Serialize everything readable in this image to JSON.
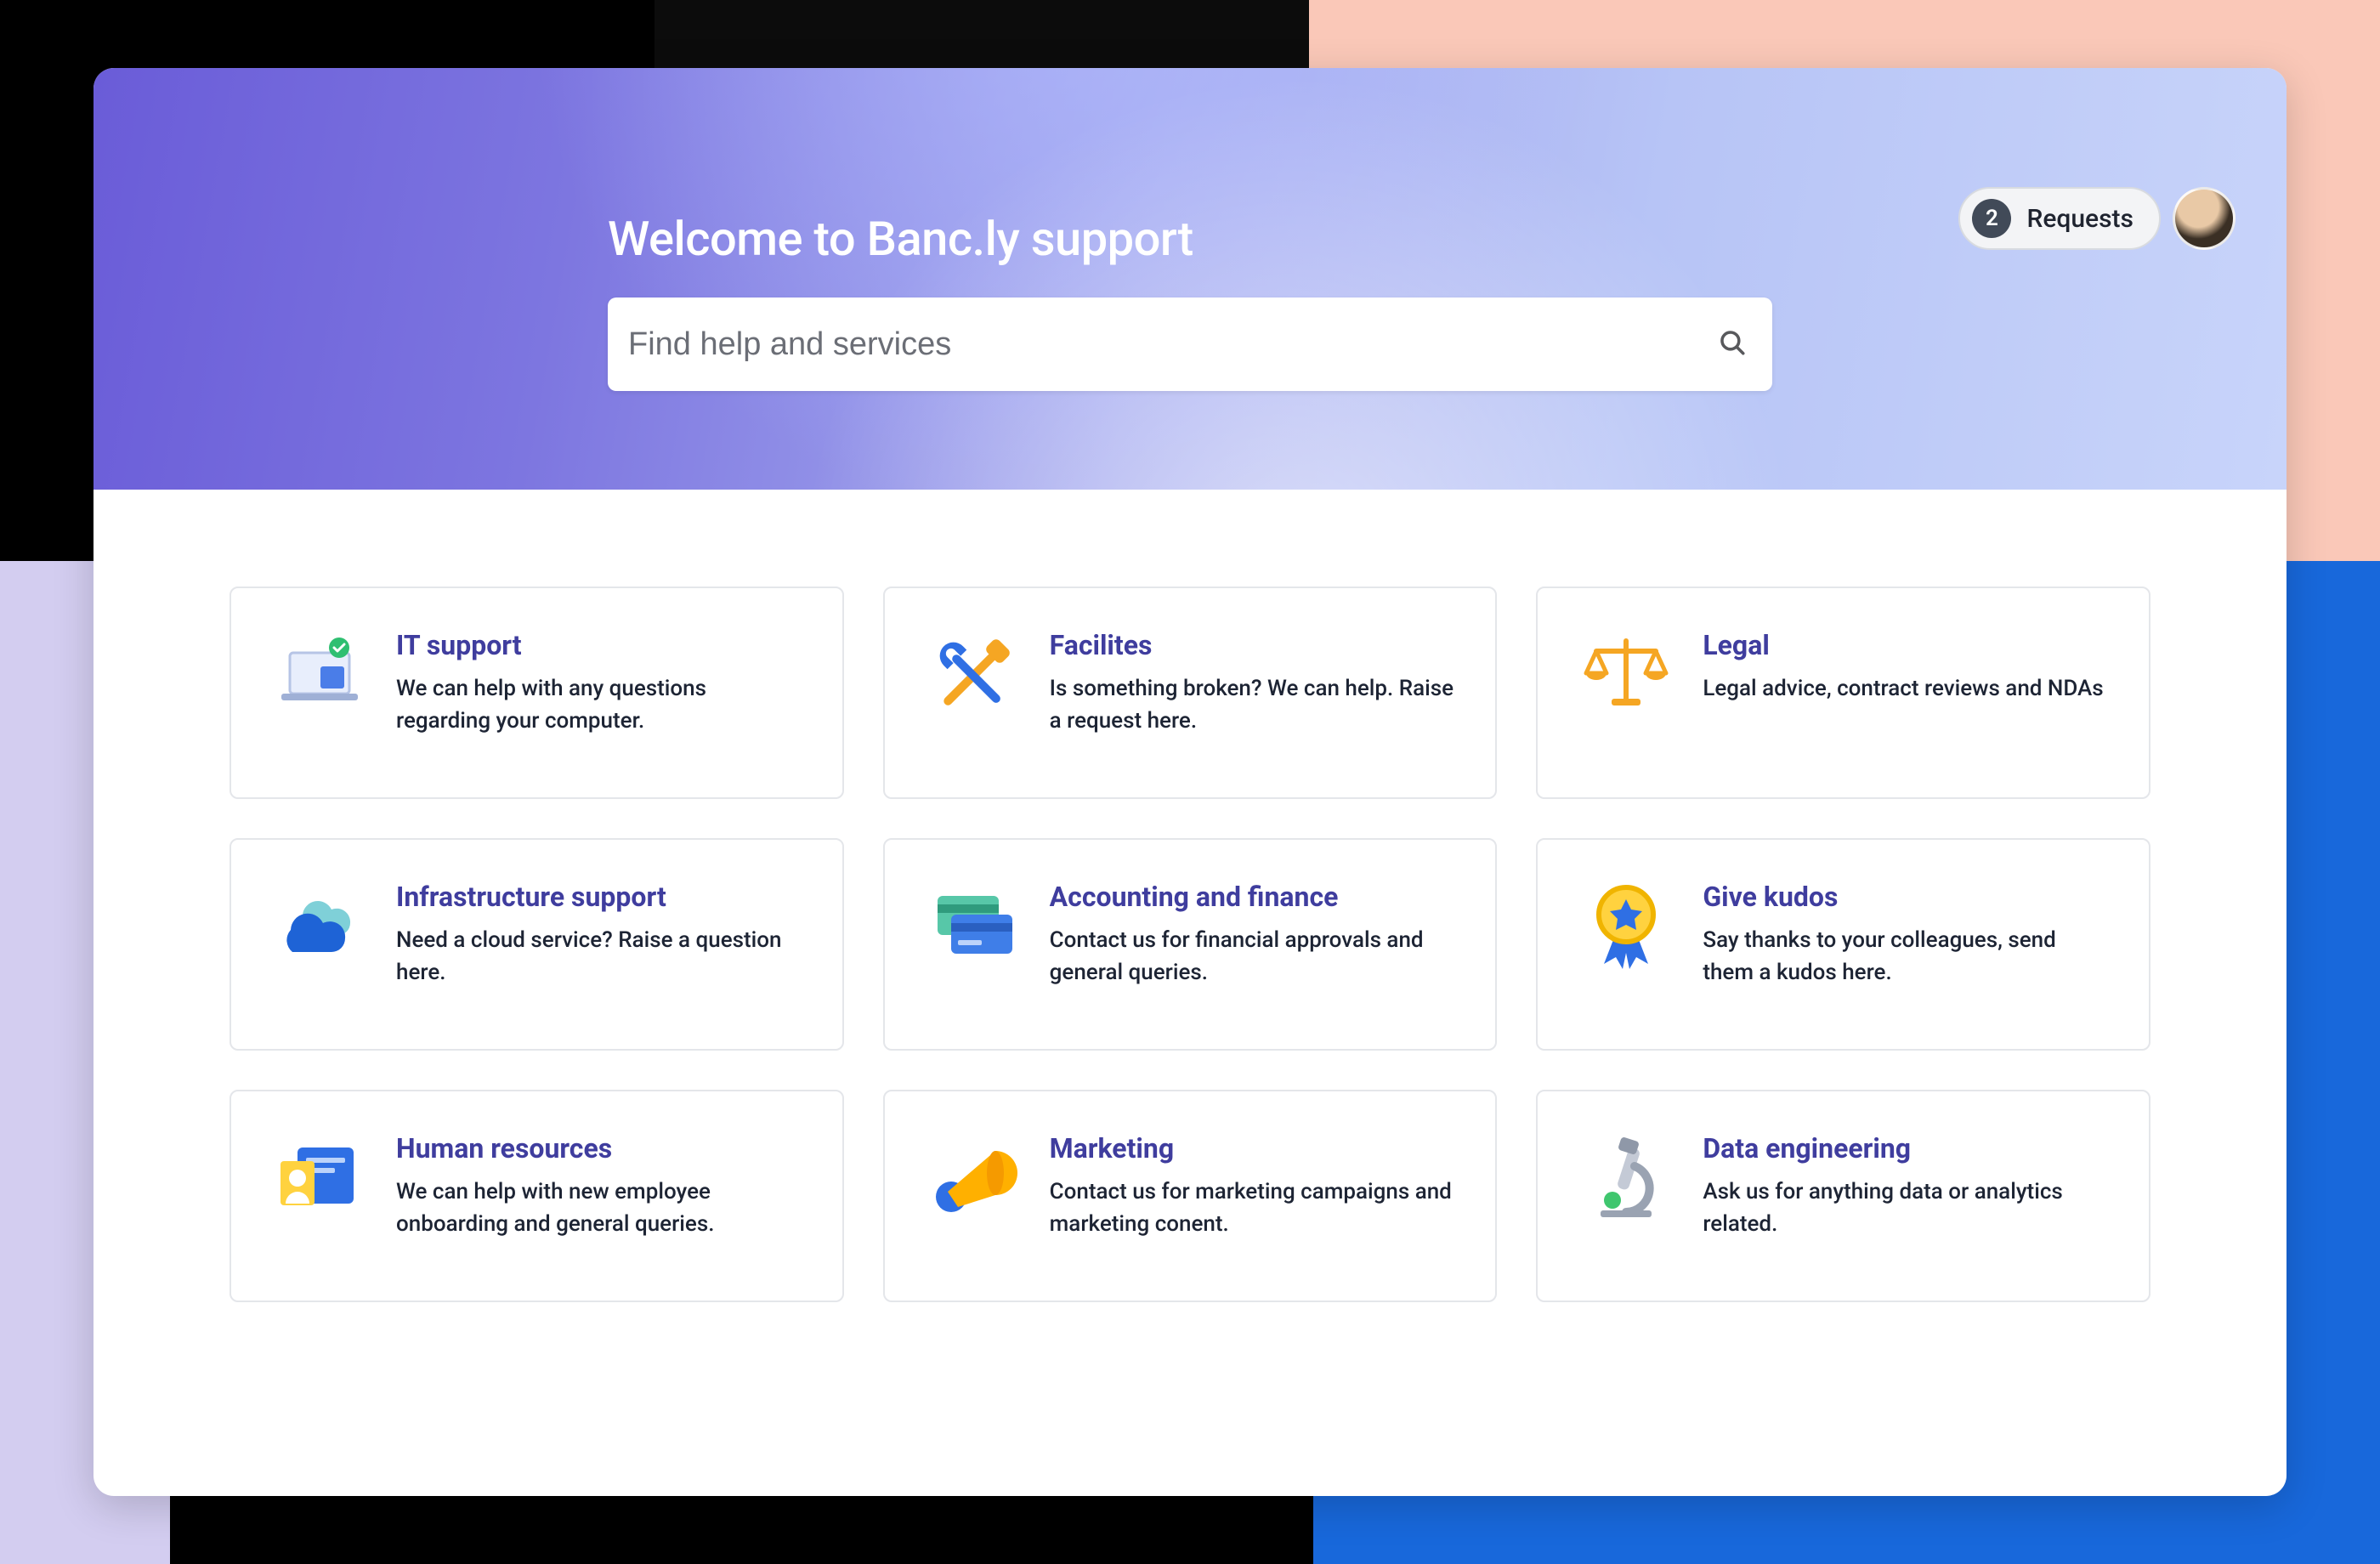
{
  "hero": {
    "title": "Welcome to Banc.ly support"
  },
  "search": {
    "placeholder": "Find help and services"
  },
  "requests": {
    "count": "2",
    "label": "Requests"
  },
  "tiles": [
    {
      "id": "it-support",
      "title": "IT support",
      "desc": "We can help with any questions regarding your computer."
    },
    {
      "id": "facilities",
      "title": "Facilites",
      "desc": "Is something broken? We can help. Raise a request here."
    },
    {
      "id": "legal",
      "title": "Legal",
      "desc": "Legal advice, contract reviews and NDAs"
    },
    {
      "id": "infrastructure-support",
      "title": "Infrastructure support",
      "desc": "Need a cloud service? Raise a question here."
    },
    {
      "id": "accounting-finance",
      "title": "Accounting and finance",
      "desc": "Contact us for financial approvals and general queries."
    },
    {
      "id": "give-kudos",
      "title": "Give kudos",
      "desc": "Say thanks to your colleagues, send them a kudos here."
    },
    {
      "id": "human-resources",
      "title": "Human resources",
      "desc": "We can help with new employee onboarding and general queries."
    },
    {
      "id": "marketing",
      "title": "Marketing",
      "desc": "Contact us for marketing campaigns and marketing conent."
    },
    {
      "id": "data-engineering",
      "title": "Data engineering",
      "desc": "Ask us for anything data or analytics related."
    }
  ]
}
